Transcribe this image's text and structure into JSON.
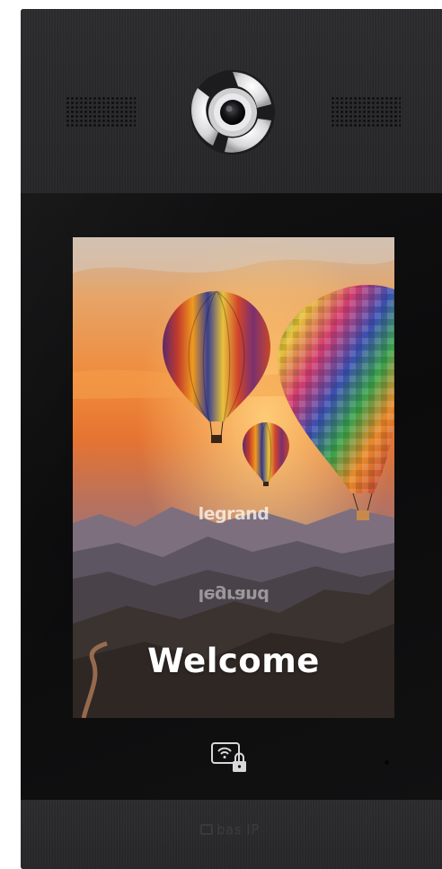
{
  "device": {
    "screen": {
      "watermark_top": "legrand",
      "watermark_mirrored": "legrand",
      "welcome_text": "Welcome"
    },
    "icons": {
      "camera": "camera-lens-icon",
      "speakers": "speaker-grille-icon",
      "card_reader": "nfc-card-lock-icon"
    },
    "brand_label": "bas IP"
  }
}
